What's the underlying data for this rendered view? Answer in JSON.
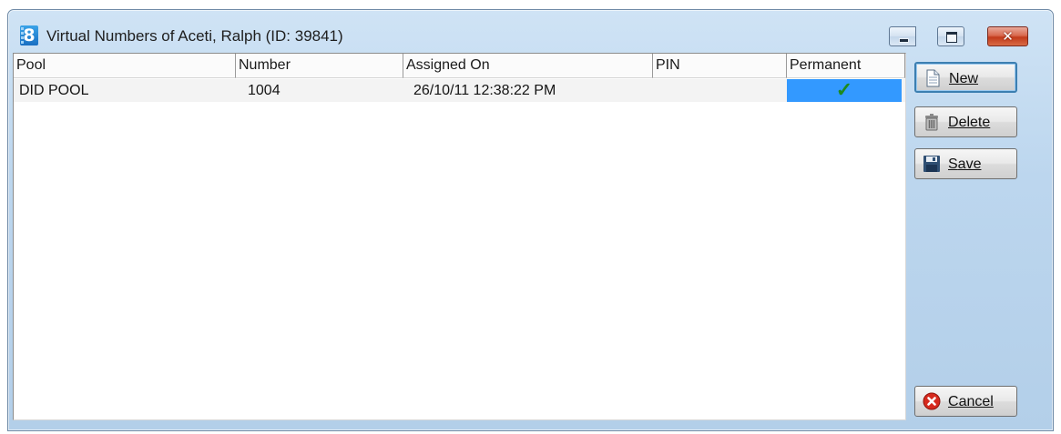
{
  "window": {
    "title": "Virtual Numbers of Aceti, Ralph (ID: 39841)",
    "app_icon_glyph": "8",
    "controls": {
      "close_glyph": "✕"
    }
  },
  "grid": {
    "columns": [
      {
        "key": "pool",
        "label": "Pool"
      },
      {
        "key": "number",
        "label": "Number"
      },
      {
        "key": "assigned_on",
        "label": "Assigned On"
      },
      {
        "key": "pin",
        "label": "PIN"
      },
      {
        "key": "permanent",
        "label": "Permanent"
      }
    ],
    "rows": [
      {
        "pool": "DID POOL",
        "number": "1004",
        "assigned_on": "26/10/11 12:38:22 PM",
        "pin": "",
        "permanent": true
      }
    ],
    "selection_color": "#3399ff",
    "check_glyph": "✓"
  },
  "buttons": {
    "new": {
      "mnemonic": "N",
      "rest": "ew"
    },
    "delete": {
      "mnemonic": "D",
      "rest": "elete"
    },
    "save": {
      "mnemonic": "S",
      "rest": "ave"
    },
    "cancel": {
      "mnemonic": "C",
      "rest": "ancel"
    }
  }
}
